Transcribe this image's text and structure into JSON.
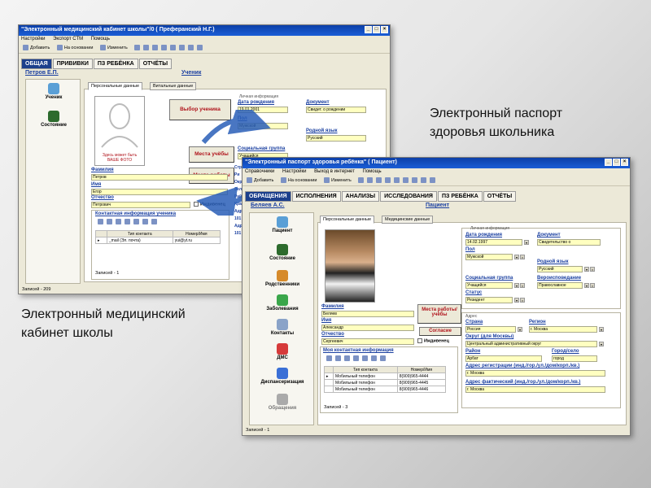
{
  "win1": {
    "title": "\"Электронный медицинский кабинет школы\"/0 ( Преферанский Н.Г.)",
    "menu": [
      "Настройки",
      "Экспорт СТМ",
      "Помощь"
    ],
    "toolbar": [
      "Добавить",
      "На основании",
      "Изменить"
    ],
    "tabs": [
      "ОБЩАЯ",
      "ПРИВИВКИ",
      "ПЗ РЕБЁНКА",
      "ОТЧЁТЫ"
    ],
    "user_link": "Петров Е.П.",
    "role_link": "Ученик",
    "side": [
      "Ученик",
      "Состояние"
    ],
    "panel_tabs": [
      "Персональные данные",
      "Витальные данные"
    ],
    "photo_text": "Здесь может быть ВАШЕ ФОТО",
    "labels": {
      "familiya": "Фамилия",
      "imya": "Имя",
      "otchestvo": "Отчество",
      "dob": "Дата рождения",
      "pol": "Пол",
      "doc": "Документ",
      "lang": "Родной язык",
      "social": "Социальная группа",
      "contact": "Контактная информация ученика",
      "personal": "Личная информация"
    },
    "values": {
      "familiya": "Петров",
      "imya": "Егор",
      "otchestvo": "Петрович",
      "dob": "19.01.2001",
      "pol": "Мужской",
      "doc": "Свидет. о рождении",
      "lang": "Русский",
      "social": "Учащийся"
    },
    "buttons": [
      "Выбор ученика",
      "Места учёбы",
      "Места работы"
    ],
    "side_labels": [
      "Стр",
      "Ри",
      "Окр",
      "Зел",
      "Рай",
      "Кра",
      "Адр",
      "101",
      "Адр",
      "101"
    ],
    "grid_head": [
      "Тип контакта",
      "Номер/Имя"
    ],
    "grid_row": [
      "_mail (Эл. почта)",
      "yui@yt.ru"
    ],
    "records_inner": "Записей - 1",
    "records": "Записей - 209"
  },
  "win2": {
    "title": "\"Электронный паспорт здоровья ребёнка\" ( Пациент)",
    "menu": [
      "Справочники",
      "Настройки",
      "Выход в интернет",
      "Помощь"
    ],
    "toolbar": [
      "Добавить",
      "На основании",
      "Изменить"
    ],
    "tabs": [
      "ОБРАЩЕНИЯ",
      "ИСПОЛНЕНИЯ",
      "АНАЛИЗЫ",
      "ИССЛЕДОВАНИЯ",
      "ПЗ РЕБЁНКА",
      "ОТЧЁТЫ"
    ],
    "user_link": "Беляев А.С.",
    "role_link": "Пациент",
    "side": [
      "Пациент",
      "Состояние",
      "Родственники",
      "Заболевания",
      "Контакты",
      "ДМС",
      "Диспансеризация",
      "Обращения"
    ],
    "panel_tabs": [
      "Персональные данные",
      "Медицинские данные"
    ],
    "labels": {
      "personal": "Личная информация",
      "dob": "Дата рождения",
      "doc": "Документ",
      "pol": "Пол",
      "lang": "Родной язык",
      "social": "Социальная группа",
      "relig": "Вероисповедание",
      "status": "Статус",
      "familiya": "Фамилия",
      "imya": "Имя",
      "otchestvo": "Отчество",
      "contact": "Моя контактная информация",
      "address": "Адрес",
      "country": "Страна",
      "region": "Регион",
      "okrug": "Округ (для Москвы)",
      "rayon": "Район",
      "gorod": "Город/село",
      "reg_addr": "Адрес регистрации (инд./гор./ул./дом/корп./кв.)",
      "fact_addr": "Адрес фактический (инд./гор./ул./дом/корп./кв.)"
    },
    "values": {
      "dob": "14.02.1997",
      "doc": "Свидетельство о",
      "pol": "Мужской",
      "lang": "Русский",
      "social": "Учащийся",
      "relig": "Православное",
      "status": "Резидент",
      "familiya": "Беляев",
      "imya": "Александр",
      "otchestvo": "Сергеевич",
      "country": "Россия",
      "region": "г. Москва",
      "okrug": "Центральный административный округ",
      "rayon": "Арбат",
      "gorod": "город",
      "reg_addr": "г. Москва",
      "fact_addr": "г. Москва"
    },
    "buttons": [
      "Места работы/учёбы",
      "Согласие"
    ],
    "checkbox": "Иждивенец",
    "grid_head": [
      "Тип контакта",
      "Номер/Имя"
    ],
    "grid_rows": [
      [
        "Мобильный телефон",
        "8(909)965-4444"
      ],
      [
        "Мобильный телефон",
        "8(909)965-4445"
      ],
      [
        "Мобильный телефон",
        "8(909)965-4446"
      ]
    ],
    "records_inner": "Записей - 3",
    "records": "Записей - 1"
  },
  "w1_chk": "Иждивенец",
  "caption_right": [
    "Электронный паспорт",
    "здоровья школьника"
  ],
  "caption_left": [
    "Электронный медицинский",
    "кабинет школы"
  ],
  "colors": {
    "titlebar": "#1b5ed6",
    "active_tab": "#1c3f8c",
    "field": "#ffffc0",
    "button_text": "#b0141c",
    "arrow": "#2a5fb8"
  }
}
